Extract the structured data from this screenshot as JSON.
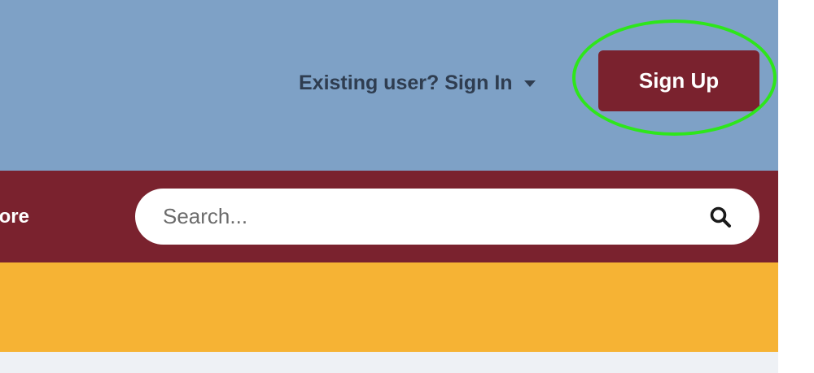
{
  "header": {
    "signin_label": "Existing user? Sign In",
    "signup_label": "Sign Up"
  },
  "nav": {
    "partial_item_label": "More"
  },
  "search": {
    "placeholder": "Search..."
  },
  "icons": {
    "signin_dropdown": "caret-down-icon",
    "search": "search-icon"
  },
  "colors": {
    "header_bg": "#7ea1c6",
    "brand_maroon": "#7a222e",
    "promo_yellow": "#f6b334",
    "body_bg": "#eef1f5",
    "header_text": "#2f3d50",
    "nav_text": "#ffffff",
    "button_text": "#ffffff",
    "search_bg": "#ffffff",
    "highlight_ring": "#2ee61b"
  }
}
